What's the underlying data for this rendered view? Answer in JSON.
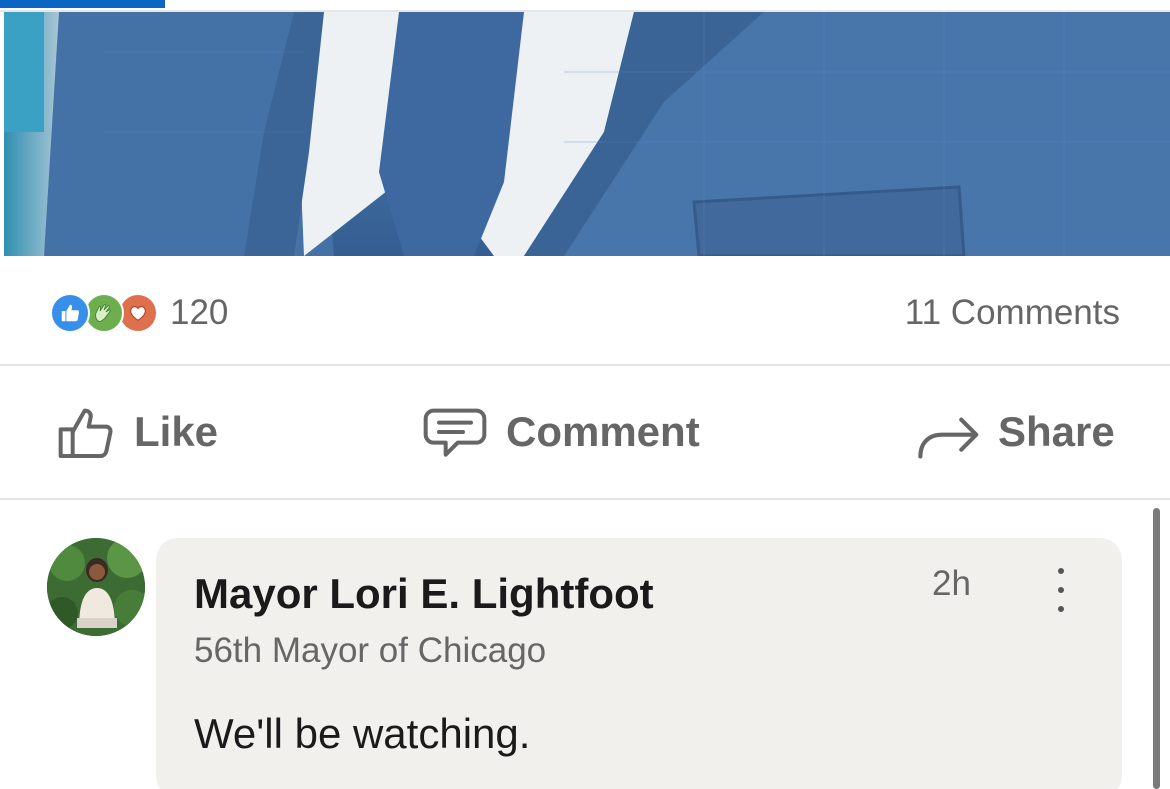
{
  "post": {
    "image_alt": "",
    "reactions": {
      "icons": [
        "like-reaction-icon",
        "celebrate-reaction-icon",
        "love-reaction-icon"
      ],
      "count": "120"
    },
    "comments_count": "11 Comments"
  },
  "actions": {
    "like_label": "Like",
    "comment_label": "Comment",
    "share_label": "Share"
  },
  "comment": {
    "author_name": "Mayor Lori E. Lightfoot",
    "author_headline": "56th Mayor of Chicago",
    "time": "2h",
    "text": "We'll be watching."
  },
  "colors": {
    "accent": "#0a66c2",
    "like_reaction": "#378fe9",
    "celebrate_reaction": "#6dae4f",
    "love_reaction": "#df704d",
    "comment_bubble": "#f2f0ed",
    "muted_text": "#666666"
  }
}
